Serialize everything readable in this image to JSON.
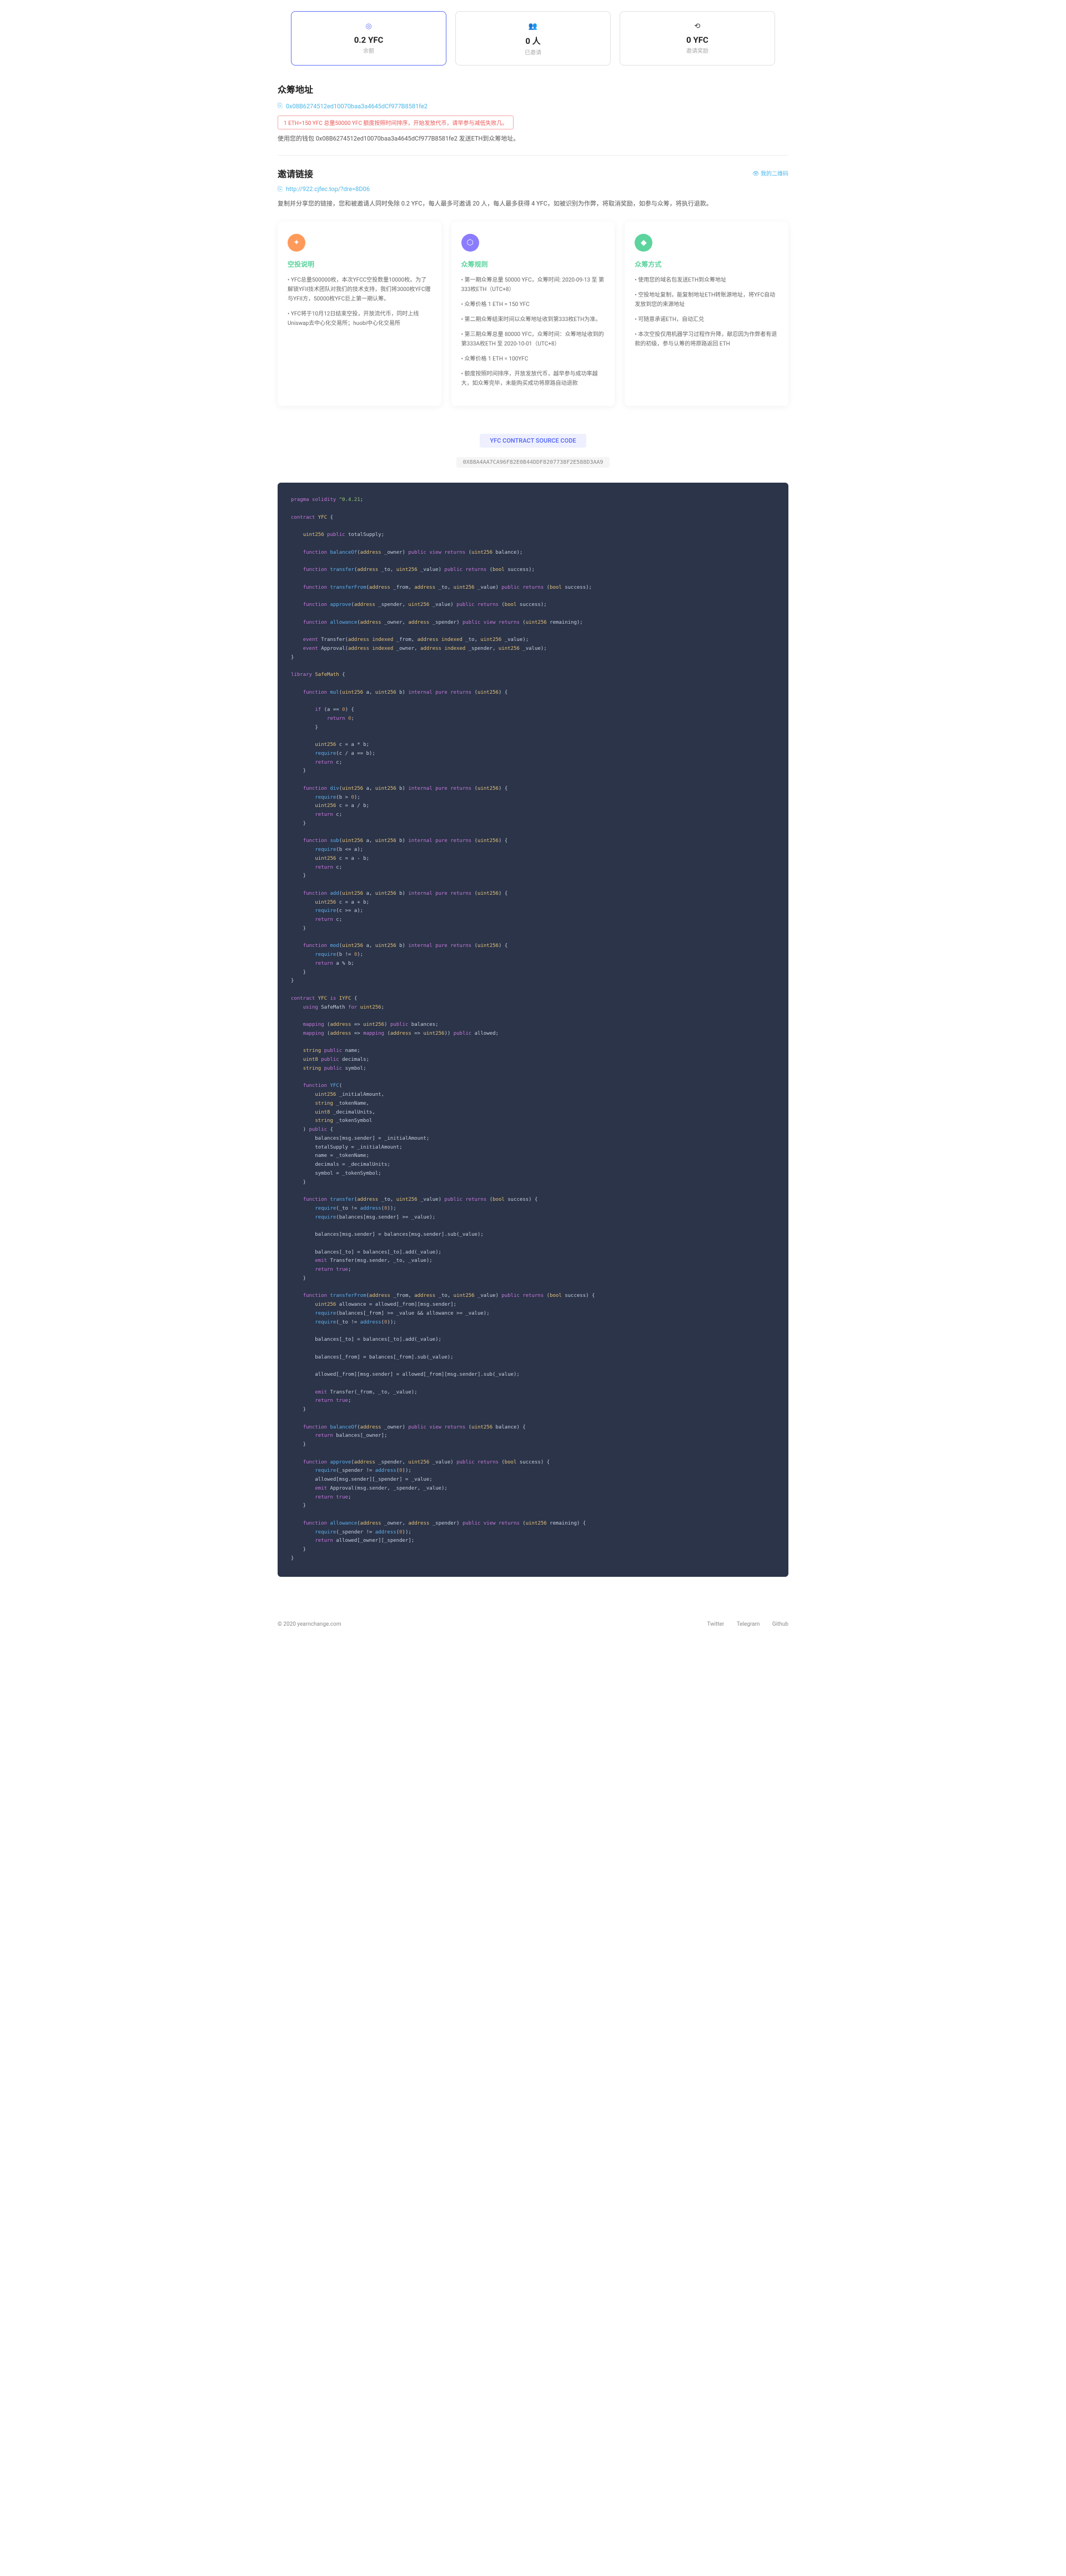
{
  "stats": [
    {
      "icon": "◎",
      "value": "0.2 YFC",
      "label": "余额",
      "active": true,
      "color": "#5b6df5"
    },
    {
      "icon": "👥",
      "value": "0 人",
      "label": "已邀请",
      "active": false,
      "color": "#777"
    },
    {
      "icon": "⟲",
      "value": "0 YFC",
      "label": "邀请奖励",
      "active": false,
      "color": "#777"
    }
  ],
  "crowdfund": {
    "title": "众筹地址",
    "address": "0x08B6274512ed10070baa3a4645dCf977B8581fe2",
    "warning": "1 ETH=150 YFC 总量50000 YFC 额度按照时间排序，开始发放代币，请早参与减低失败几。",
    "desc": "使用您的钱包 0x08B6274512ed10070baa3a4645dCf977B8581fe2 发送ETH到众筹地址。"
  },
  "invite": {
    "title": "邀请链接",
    "qr_label": "👁 我的二维码",
    "link": "http://922.cjfec.top/?dre=8D06",
    "desc": "复制并分享您的链接，您和被邀请人同时免除 0.2 YFC，每人最多可邀请 20 人，每人最多获得 4 YFC，如被识别为作弊，将取消奖励，如参与众筹，将执行退款。"
  },
  "cards": [
    {
      "icon": "✦",
      "iconClass": "ic-orange",
      "title": "空投说明",
      "items": [
        "• YFC总量500000枚，本次YFCC空投数量10000枚。为了解锁YFII技术团队对我们的技术支持，我们将3000枚YFC赠与YFII方，50000枚YFC巨上第一期认筹。",
        "• YFC将于10月12日结束空投，开放流代币，同时上线Uniswap去中心化交易所；huobi中心化交易所"
      ]
    },
    {
      "icon": "⬡",
      "iconClass": "ic-blue",
      "title": "众筹规则",
      "items": [
        "• 第一期众筹总量 50000 YFC，众筹时间: 2020-09-13 至 第333枚ETH（UTC+8）",
        "• 众筹价格 1 ETH = 150 YFC",
        "• 第二期众筹结束时间以众筹地址收到第333枚ETH为准。",
        "• 第三期众筹总量 80000 YFC，众筹时间：众筹地址收到的第333A枚ETH 至 2020-10-01（UTC+8）",
        "• 众筹价格 1 ETH = 100YFC",
        "• 额度按照时间排序，开放发放代币，越早参与成功率越大，如众筹完毕，未能购买成功将原路自动退款"
      ]
    },
    {
      "icon": "◆",
      "iconClass": "ic-green",
      "title": "众筹方式",
      "items": [
        "• 使用您的域名包发送ETH到众筹地址",
        "• 空投地址复制，能复制地址ETH转账源地址，将YFC自动发放到您的来源地址",
        "• 可随意承诺ETH，自动汇兑",
        "• 本次空投仅用机器学习过程作升降，献忍因为作弊者有退款的初级，参与认筹的将原路返回 ETH"
      ]
    }
  ],
  "code": {
    "title": "YFC CONTRACT SOURCE CODE",
    "hash": "0X88A4AA7CA96F82E0B44DDF8207738F2E588D3AA9"
  },
  "footer": {
    "copy": "© 2020 yearnchange.com",
    "links": [
      "Twitter",
      "Telegram",
      "Github"
    ]
  }
}
